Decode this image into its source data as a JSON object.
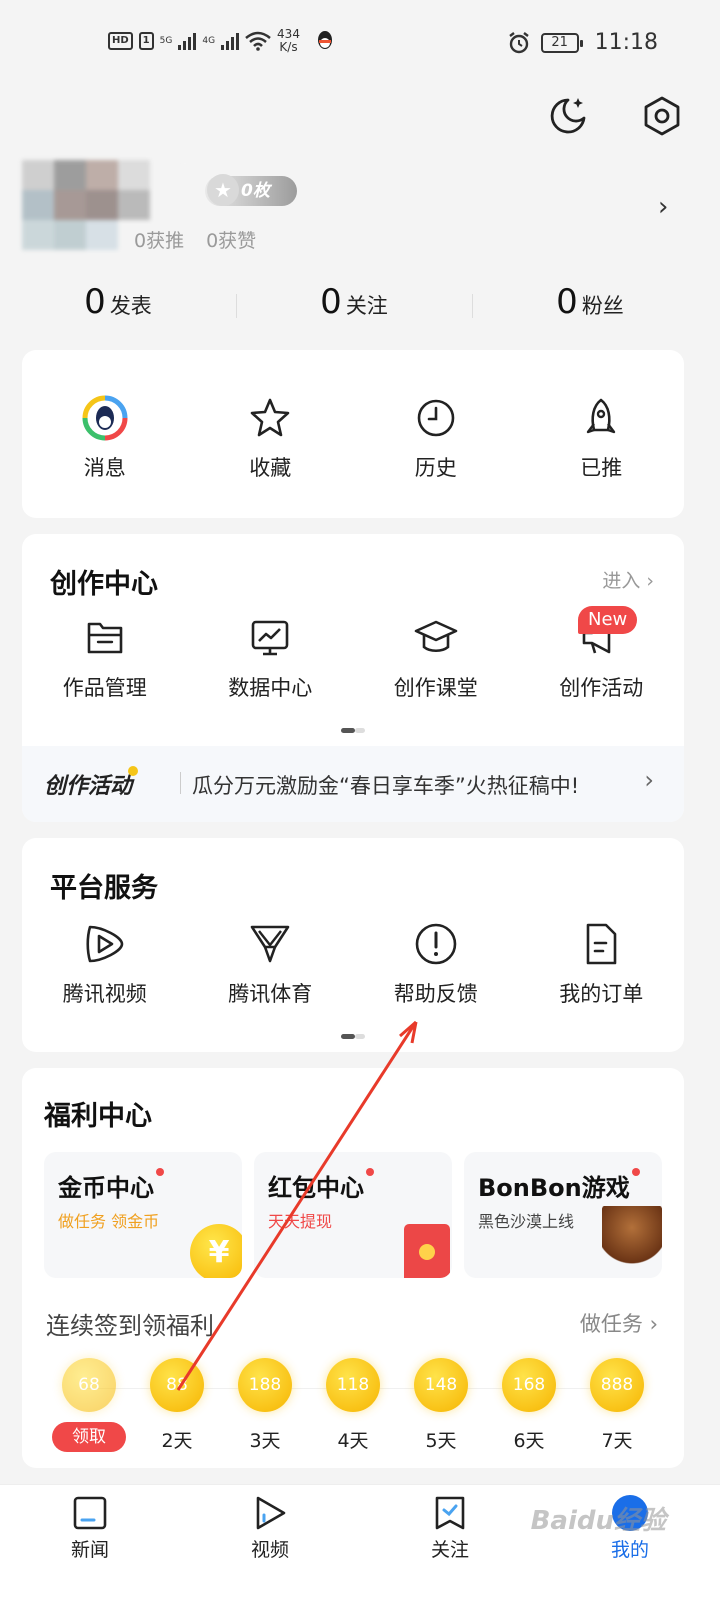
{
  "status": {
    "speed_value": "434",
    "speed_unit": "K/s",
    "battery": "21",
    "time": "11:18",
    "network_1": "5G",
    "network_2": "4G",
    "hd": "HD"
  },
  "profile": {
    "badge": "0枚",
    "recommends": "0获推",
    "likes": "0获赞"
  },
  "stats": [
    {
      "num": "0",
      "label": "发表"
    },
    {
      "num": "0",
      "label": "关注"
    },
    {
      "num": "0",
      "label": "粉丝"
    }
  ],
  "quick": [
    {
      "label": "消息",
      "icon": "message-icon"
    },
    {
      "label": "收藏",
      "icon": "star-icon"
    },
    {
      "label": "历史",
      "icon": "clock-icon"
    },
    {
      "label": "已推",
      "icon": "rocket-icon"
    }
  ],
  "creation": {
    "title": "创作中心",
    "enter": "进入",
    "items": [
      {
        "label": "作品管理",
        "icon": "folder-icon"
      },
      {
        "label": "数据中心",
        "icon": "chart-icon"
      },
      {
        "label": "创作课堂",
        "icon": "graduation-cap-icon"
      },
      {
        "label": "创作活动",
        "icon": "megaphone-icon"
      }
    ],
    "new_tag": "New",
    "banner_tag": "创作活动",
    "banner_text": "瓜分万元激励金“春日享车季”火热征稿中!"
  },
  "platform": {
    "title": "平台服务",
    "items": [
      {
        "label": "腾讯视频",
        "icon": "play-icon"
      },
      {
        "label": "腾讯体育",
        "icon": "trophy-icon"
      },
      {
        "label": "帮助反馈",
        "icon": "alert-icon"
      },
      {
        "label": "我的订单",
        "icon": "document-icon"
      }
    ]
  },
  "welfare": {
    "title": "福利中心",
    "tiles": [
      {
        "title": "金币中心",
        "sub": "做任务 领金币",
        "sub_color": "#f0a020"
      },
      {
        "title": "红包中心",
        "sub": "天天提现",
        "sub_color": "#f04848"
      },
      {
        "title": "BonBon游戏",
        "sub": "黑色沙漠上线",
        "sub_color": "#444444"
      }
    ],
    "coin_symbol": "¥",
    "signin_title": "连续签到领福利",
    "do_task": "做任务",
    "days": [
      {
        "coin": "68",
        "label": "领取"
      },
      {
        "coin": "88",
        "label": "2天"
      },
      {
        "coin": "188",
        "label": "3天"
      },
      {
        "coin": "118",
        "label": "4天"
      },
      {
        "coin": "148",
        "label": "5天"
      },
      {
        "coin": "168",
        "label": "6天"
      },
      {
        "coin": "888",
        "label": "7天"
      }
    ]
  },
  "nav": [
    {
      "label": "新闻",
      "icon": "news-icon"
    },
    {
      "label": "视频",
      "icon": "video-icon"
    },
    {
      "label": "关注",
      "icon": "follow-icon"
    },
    {
      "label": "我的",
      "icon": "me-icon"
    }
  ],
  "watermark": "Baidu经验",
  "colors": {
    "accent": "#1a6ee8",
    "red": "#f04848",
    "gold": "#f6b400"
  }
}
